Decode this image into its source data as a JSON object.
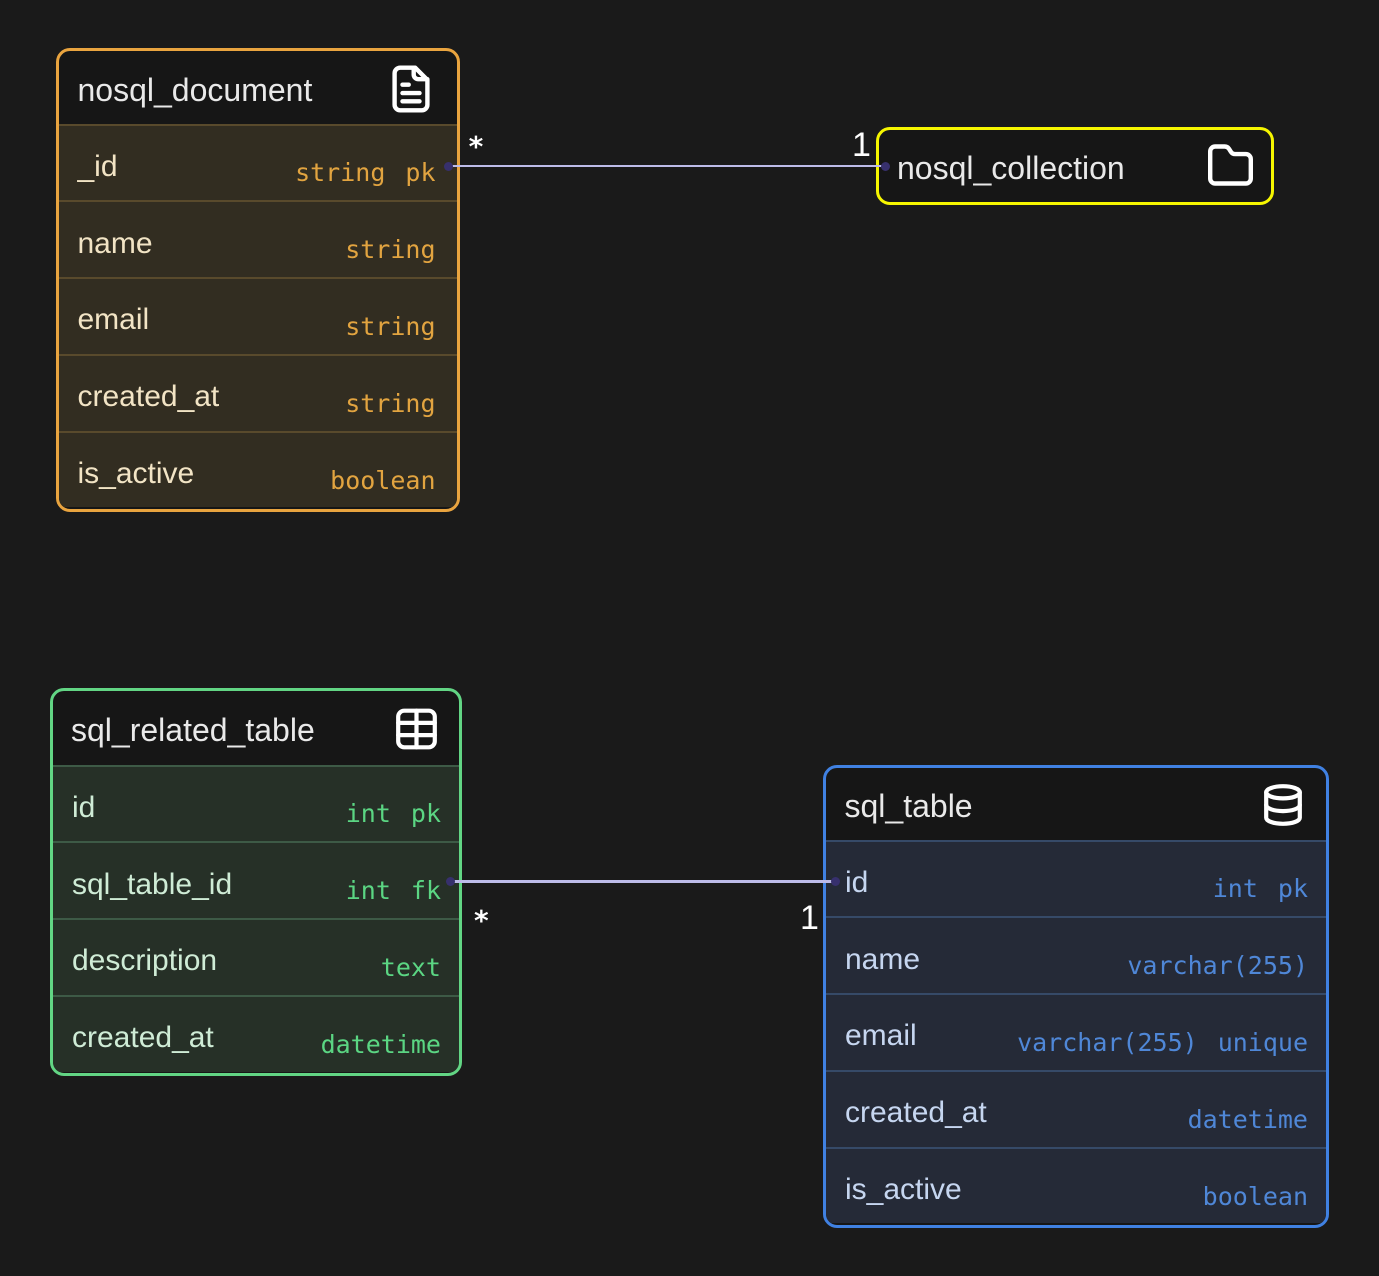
{
  "canvas": {
    "background": "#1a1a1a"
  },
  "diagram": {
    "entities": [
      {
        "title": "nosql_document",
        "icon": "file-text-icon",
        "accent": "#e9a43f",
        "fields": [
          {
            "name": "_id",
            "type": "string",
            "constraint": "pk"
          },
          {
            "name": "name",
            "type": "string",
            "constraint": ""
          },
          {
            "name": "email",
            "type": "string",
            "constraint": ""
          },
          {
            "name": "created_at",
            "type": "string",
            "constraint": ""
          },
          {
            "name": "is_active",
            "type": "boolean",
            "constraint": ""
          }
        ]
      },
      {
        "title": "nosql_collection",
        "icon": "folder-icon",
        "accent": "#f6f600",
        "fields": []
      },
      {
        "title": "sql_related_table",
        "icon": "table-icon",
        "accent": "#62d584",
        "fields": [
          {
            "name": "id",
            "type": "int",
            "constraint": "pk"
          },
          {
            "name": "sql_table_id",
            "type": "int",
            "constraint": "fk"
          },
          {
            "name": "description",
            "type": "text",
            "constraint": ""
          },
          {
            "name": "created_at",
            "type": "datetime",
            "constraint": ""
          }
        ]
      },
      {
        "title": "sql_table",
        "icon": "database-icon",
        "accent": "#4081e2",
        "fields": [
          {
            "name": "id",
            "type": "int",
            "constraint": "pk"
          },
          {
            "name": "name",
            "type": "varchar(255)",
            "constraint": ""
          },
          {
            "name": "email",
            "type": "varchar(255)",
            "constraint": "unique"
          },
          {
            "name": "created_at",
            "type": "datetime",
            "constraint": ""
          },
          {
            "name": "is_active",
            "type": "boolean",
            "constraint": ""
          }
        ]
      }
    ],
    "relationships": [
      {
        "from": "nosql_document._id",
        "to": "nosql_collection",
        "source_cardinality": "*",
        "target_cardinality": "1",
        "line_color": "#bdbce9"
      },
      {
        "from": "sql_related_table.sql_table_id",
        "to": "sql_table.id",
        "source_cardinality": "*",
        "target_cardinality": "1",
        "line_color": "#bdbce9"
      }
    ]
  }
}
